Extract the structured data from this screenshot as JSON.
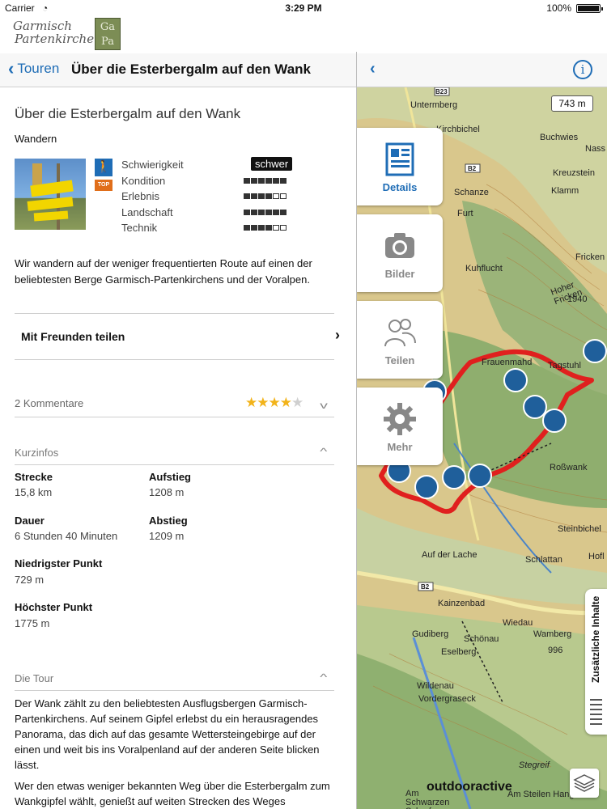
{
  "status_bar": {
    "carrier": "Carrier",
    "time": "3:29 PM",
    "battery": "100%"
  },
  "brand": {
    "logo_line1": "Garmisch",
    "logo_line2": "Partenkirchen",
    "badge_line1": "Ga",
    "badge_line2": "Pa"
  },
  "nav": {
    "back_label": "Touren",
    "title": "Über die Esterbergalm auf den Wank"
  },
  "tour": {
    "title": "Über die Esterbergalm auf den Wank",
    "category": "Wandern",
    "top_badge": "TOP",
    "difficulty": "schwer",
    "ratings": [
      {
        "label": "Schwierigkeit",
        "value": null
      },
      {
        "label": "Kondition",
        "value": 6
      },
      {
        "label": "Erlebnis",
        "value": 4
      },
      {
        "label": "Landschaft",
        "value": 6
      },
      {
        "label": "Technik",
        "value": 4
      }
    ],
    "rating_max": 6,
    "description": "Wir wandern auf der weniger frequentierten Route auf einen der beliebtesten Berge Garmisch-Partenkirchens und der Voralpen.",
    "share_label": "Mit Freunden teilen",
    "comments_label": "2 Kommentare",
    "stars": 4,
    "stars_max": 5,
    "kurzinfos_label": "Kurzinfos",
    "info": {
      "strecke_label": "Strecke",
      "strecke": "15,8 km",
      "aufstieg_label": "Aufstieg",
      "aufstieg": "1208 m",
      "dauer_label": "Dauer",
      "dauer": "6 Stunden 40 Minuten",
      "abstieg_label": "Abstieg",
      "abstieg": "1209 m",
      "niedrigster_label": "Niedrigster Punkt",
      "niedrigster": "729 m",
      "hoechster_label": "Höchster Punkt",
      "hoechster": "1775 m"
    },
    "tour_section_label": "Die Tour",
    "tour_text_1": "Der Wank zählt zu den beliebtesten Ausflugsbergen Garmisch-Partenkirchens. Auf seinem Gipfel erlebst du ein herausragendes Panorama, das dich auf das gesamte Wettersteingebirge auf der einen und weit bis ins Voralpenland auf der anderen Seite blicken lässt.",
    "tour_text_2": "Wer den etwas weniger bekannten Weg über die Esterbergalm zum Wankgipfel wählt, genießt auf weiten Strecken des Weges"
  },
  "map": {
    "scale": "743 m",
    "tabs": [
      {
        "label": "Details",
        "icon": "document-icon"
      },
      {
        "label": "Bilder",
        "icon": "camera-icon"
      },
      {
        "label": "Teilen",
        "icon": "people-icon"
      },
      {
        "label": "Mehr",
        "icon": "gear-icon"
      }
    ],
    "side_panel": "Zusätzliche Inhalte",
    "watermark": "outdooractive",
    "labels": [
      "Untermberg",
      "Kirchbichel",
      "Buchwies",
      "Nass",
      "Kreuzstein",
      "Klamm",
      "Schanze",
      "Furt",
      "Kuhflucht",
      "Fricken",
      "Hoher Fricken",
      "1940",
      "Frauenmahd",
      "Tagstuhl",
      "Roßwank",
      "Steinbichel",
      "Auf der Lache",
      "Schlattan",
      "Hofl",
      "Kainzenbad",
      "Wiedau",
      "Gudiberg",
      "Schönau",
      "Wamberg",
      "Eselberg",
      "996",
      "Wildenau",
      "Vordergraseck",
      "Stegreif",
      "Am Steilen Hang",
      "Am Schwarzen Schrofen",
      "B23",
      "B2"
    ],
    "colors": {
      "route": "#e0201e",
      "poi": "#1f5f9b",
      "accent": "#1f6db6"
    }
  }
}
